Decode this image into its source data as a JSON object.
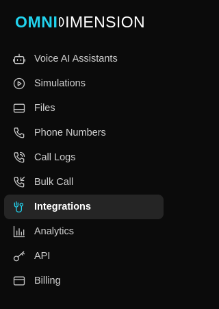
{
  "brand": {
    "logo_left": "OMNI",
    "logo_right": "IMENSION",
    "accent_color": "#22d3ee"
  },
  "nav": {
    "items": [
      {
        "label": "Voice AI Assistants",
        "icon": "robot-icon"
      },
      {
        "label": "Simulations",
        "icon": "play-circle-icon"
      },
      {
        "label": "Files",
        "icon": "file-card-icon"
      },
      {
        "label": "Phone Numbers",
        "icon": "phone-icon"
      },
      {
        "label": "Call Logs",
        "icon": "phone-log-icon"
      },
      {
        "label": "Bulk Call",
        "icon": "phone-incoming-icon"
      },
      {
        "label": "Integrations",
        "icon": "integrations-icon",
        "active": true
      },
      {
        "label": "Analytics",
        "icon": "bar-chart-icon"
      },
      {
        "label": "API",
        "icon": "key-icon"
      },
      {
        "label": "Billing",
        "icon": "credit-card-icon"
      }
    ]
  }
}
